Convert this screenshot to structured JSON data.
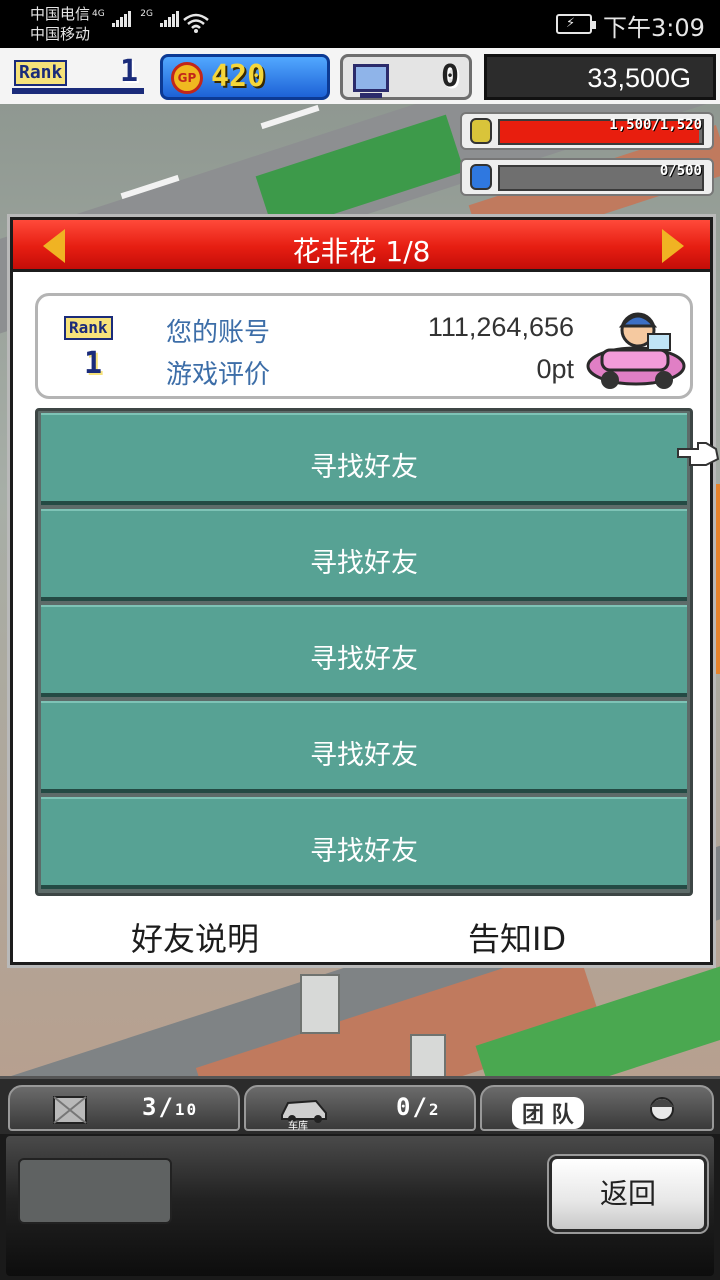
{
  "status_bar": {
    "carrier_1": "中国电信",
    "carrier_1_tag": "4G",
    "carrier_2": "中国移动",
    "carrier_2_tag": "2G",
    "time": "下午3:09"
  },
  "hud": {
    "rank_label": "Rank",
    "rank_value": "1",
    "gp_label": "GP",
    "gp_value": "420",
    "pc_value": "0",
    "money": "33,500G",
    "resource_1_text": "1,500/1,520",
    "resource_1_level": 0.987,
    "resource_1_color": "#e81e0e",
    "resource_2_text": "0/500",
    "resource_2_level": 0.0
  },
  "panel": {
    "title": "花非花 1/8",
    "card": {
      "rank_label": "Rank",
      "rank_value": "1",
      "account_label": "您的账号",
      "account_value": "111,264,656",
      "rating_label": "游戏评价",
      "rating_value": "0pt"
    },
    "friend_rows": [
      {
        "label": "寻找好友"
      },
      {
        "label": "寻找好友"
      },
      {
        "label": "寻找好友"
      },
      {
        "label": "寻找好友"
      },
      {
        "label": "寻找好友"
      }
    ],
    "footer_left": "好友说明",
    "footer_right": "告知ID",
    "header_color": "#e61e12",
    "row_color": "#57a294"
  },
  "bottom_bar": {
    "tab_1_count": "3",
    "tab_1_max": "10",
    "tab_2_label": "车库",
    "tab_2_count": "0",
    "tab_2_max": "2",
    "tab_3_label": "团 队",
    "back_label": "返回"
  }
}
